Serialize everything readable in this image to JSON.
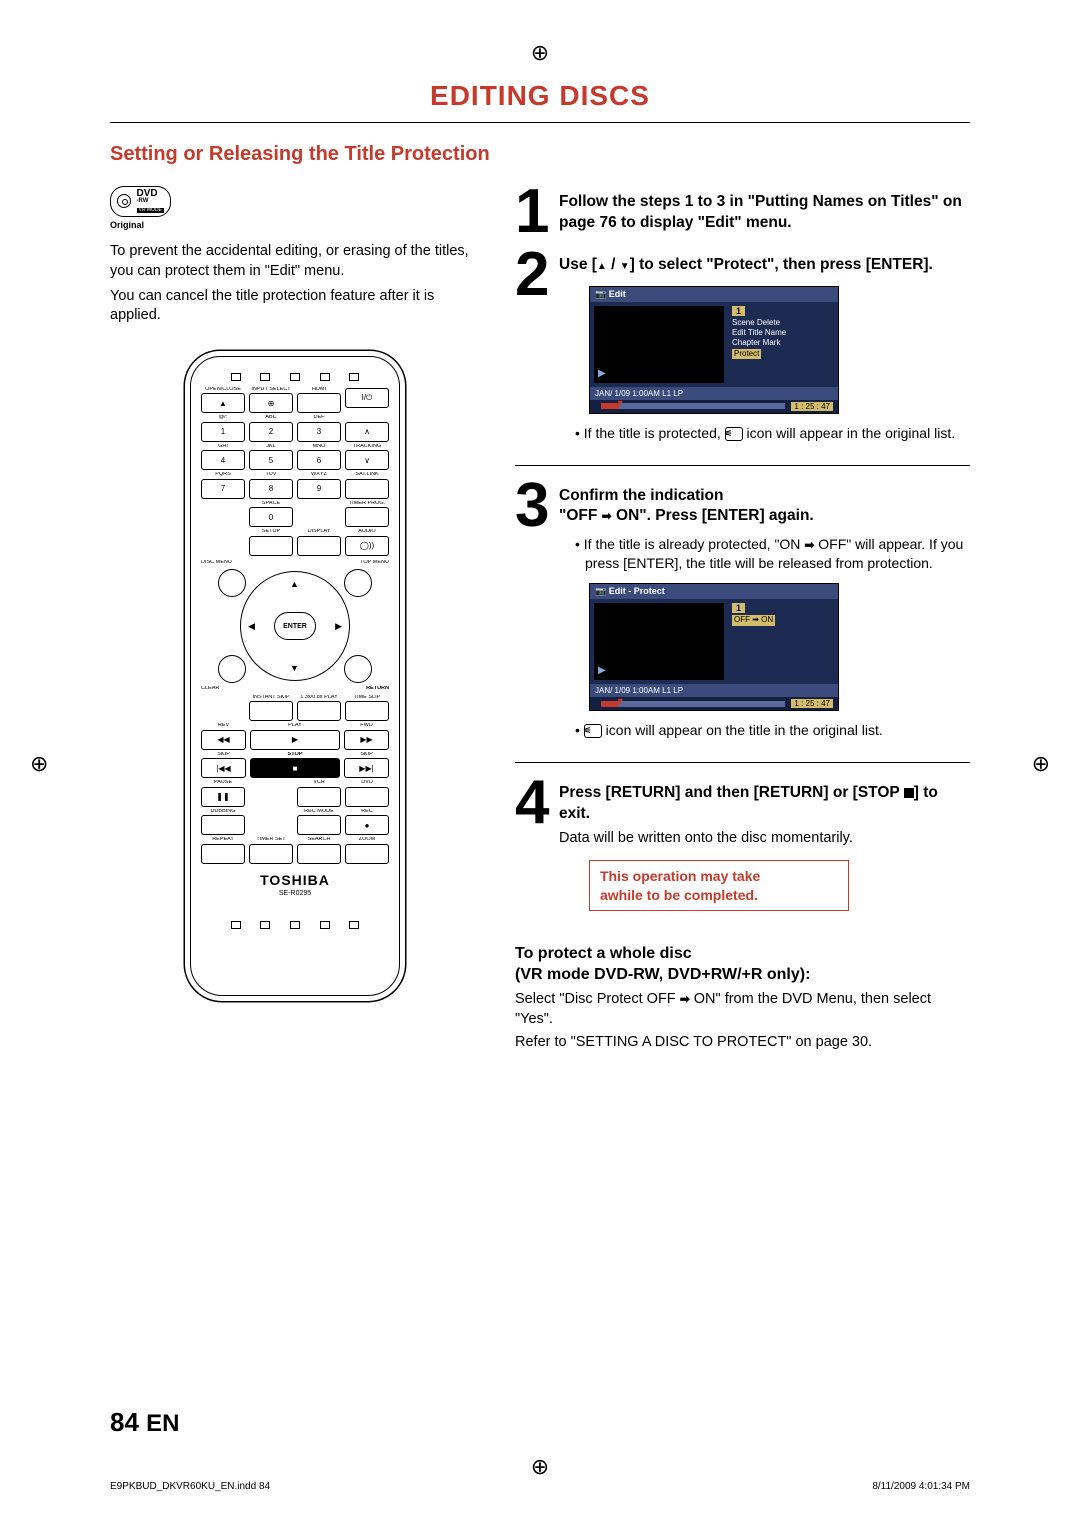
{
  "page_title": "EDITING DISCS",
  "section_heading": "Setting or Releasing the Title Protection",
  "dvd_badge": {
    "line1": "DVD",
    "line2": "-RW",
    "line3": "VR MODE",
    "caption": "Original"
  },
  "intro_para_1": "To prevent the accidental editing, or erasing of the titles, you can protect them in \"Edit\" menu.",
  "intro_para_2": "You can cancel the title protection feature after it is applied.",
  "remote": {
    "brand": "TOSHIBA",
    "model": "SE-R0295",
    "labels": {
      "r1": [
        "OPEN/CLOSE",
        "INPUT SELECT",
        "HDMI",
        ""
      ],
      "r2": [
        "@/:",
        "ABC",
        "DEF",
        ""
      ],
      "r2b": [
        "1",
        "2",
        "3",
        ""
      ],
      "r3": [
        "GHI",
        "JKL",
        "MNO",
        "TRACKING"
      ],
      "r3b": [
        "4",
        "5",
        "6",
        ""
      ],
      "r4": [
        "PQRS",
        "TUV",
        "WXYZ",
        "SAT.LINK"
      ],
      "r4b": [
        "7",
        "8",
        "9",
        ""
      ],
      "r5": [
        "",
        "SPACE",
        "",
        "TIMER PROG."
      ],
      "r5b": [
        "",
        "0",
        "",
        ""
      ],
      "r6": [
        "",
        "SETUP",
        "DISPLAY",
        "AUDIO"
      ],
      "discmenu": "DISC MENU",
      "topmenu": "TOP MENU",
      "clear": "CLEAR",
      "return": "RETURN",
      "enter": "ENTER",
      "r7": [
        "",
        "INSTANT SKIP",
        "1.3x/0.8x PLAY",
        "TIME SLIP"
      ],
      "r8": [
        "REV",
        "",
        "PLAY",
        "",
        "FWD"
      ],
      "r9": [
        "SKIP",
        "",
        "STOP",
        "",
        "SKIP"
      ],
      "r10": [
        "PAUSE",
        "",
        "VCR",
        "DVD"
      ],
      "r11": [
        "DUBBING",
        "",
        "REC MODE",
        "REC"
      ],
      "r12": [
        "REPEAT",
        "TIMER SET",
        "SEARCH",
        "ZOOM"
      ]
    }
  },
  "steps": [
    {
      "num": "1",
      "heading": "Follow the steps 1 to 3 in \"Putting Names on Titles\" on page 76 to display \"Edit\" menu."
    },
    {
      "num": "2",
      "heading_pre": "Use [",
      "heading_mid": " / ",
      "heading_post": "] to select \"Protect\", then press [ENTER].",
      "osd": {
        "title": "Edit",
        "tag": "1",
        "menu": [
          "Scene Delete",
          "Edit Title Name",
          "Chapter Mark",
          "Protect"
        ],
        "selected": "Protect",
        "foot1": "JAN/ 1/09 1:00AM L1   LP",
        "time": "1 : 25 : 47"
      },
      "bullet": "If the title is protected, ",
      "bullet_after": " icon will appear in the original list."
    },
    {
      "num": "3",
      "heading_line1": "Confirm the indication",
      "heading_pre": "\"OFF ",
      "heading_post": " ON\". Press [ENTER] again.",
      "bullet_pre": "If the title is already protected, \"ON ",
      "bullet_post": " OFF\" will appear. If you press [ENTER], the title will be released from protection.",
      "osd": {
        "title": "Edit - Protect",
        "tag": "1",
        "menu_single_pre": "OFF ",
        "menu_single_post": " ON",
        "foot1": "JAN/ 1/09 1:00AM L1   LP",
        "time": "1 : 25 : 47"
      },
      "bullet2_after": " icon will appear on the title in the original list."
    },
    {
      "num": "4",
      "heading_pre": "Press [RETURN] and then [RETURN] or [STOP ",
      "heading_post": "] to exit.",
      "body": "Data will be written onto the disc momentarily.",
      "note_line1": "This operation may take",
      "note_line2": "awhile to be completed."
    }
  ],
  "whole_disc": {
    "heading_line1": "To protect a whole disc",
    "heading_line2": "(VR mode DVD-RW, DVD+RW/+R only):",
    "body_pre": "Select \"Disc Protect OFF ",
    "body_post": " ON\" from the DVD Menu, then select \"Yes\".",
    "body2": "Refer to \"SETTING A DISC TO PROTECT\" on page 30."
  },
  "page_number": "84",
  "page_lang": "EN",
  "footer_left": "E9PKBUD_DKVR60KU_EN.indd   84",
  "footer_right": "8/11/2009   4:01:34 PM"
}
